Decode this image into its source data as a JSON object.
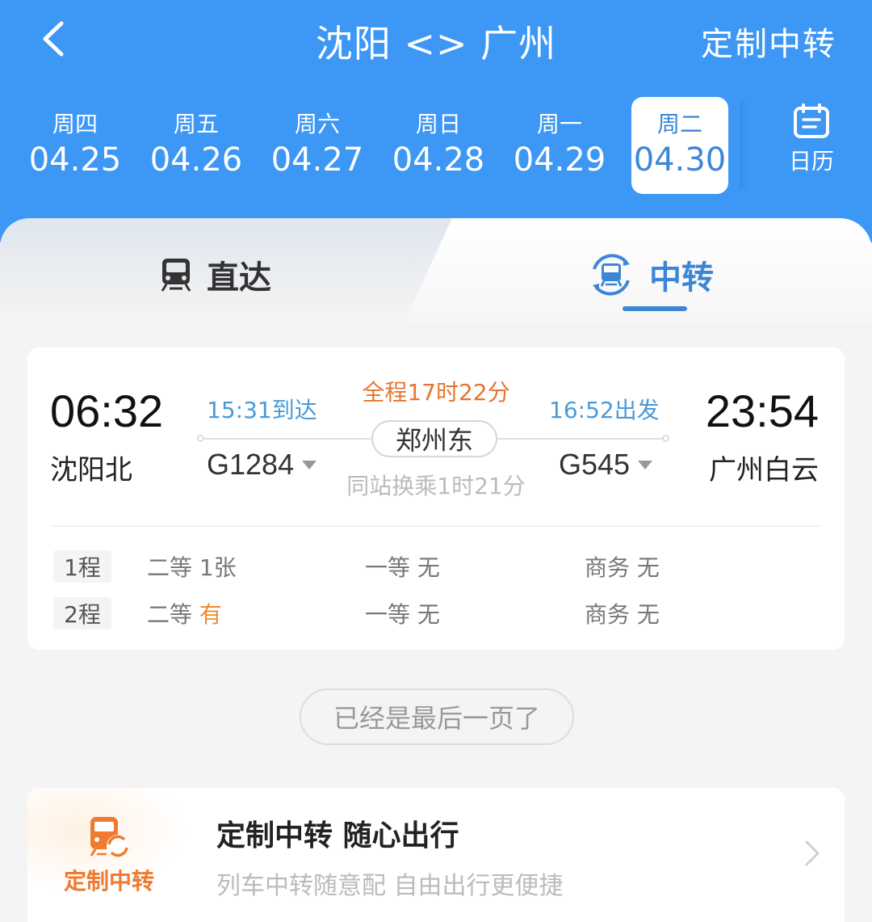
{
  "header": {
    "title": "沈阳 <> 广州",
    "custom_transfer_link": "定制中转",
    "back_icon": "chevron-left-icon",
    "colors": {
      "brand": "#3d97f5",
      "active_date_text": "#3d86d6"
    }
  },
  "dates": [
    {
      "weekday": "周四",
      "date": "04.25",
      "selected": false
    },
    {
      "weekday": "周五",
      "date": "04.26",
      "selected": false
    },
    {
      "weekday": "周六",
      "date": "04.27",
      "selected": false
    },
    {
      "weekday": "周日",
      "date": "04.28",
      "selected": false
    },
    {
      "weekday": "周一",
      "date": "04.29",
      "selected": false
    },
    {
      "weekday": "周二",
      "date": "04.30",
      "selected": true
    }
  ],
  "calendar": {
    "label": "日历",
    "icon": "calendar-icon"
  },
  "tabs": [
    {
      "label": "直达",
      "icon": "train-icon",
      "active": false
    },
    {
      "label": "中转",
      "icon": "train-transfer-icon",
      "active": true
    }
  ],
  "result": {
    "departure_time": "06:32",
    "departure_station": "沈阳北",
    "arrival_time": "23:54",
    "arrival_station": "广州白云",
    "total_duration": "全程17时22分",
    "transfer_station": "郑州东",
    "transfer_info": "同站换乘1时21分",
    "leg1": {
      "train_no": "G1284",
      "arrive_text": "15:31到达"
    },
    "leg2": {
      "train_no": "G545",
      "depart_text": "16:52出发"
    },
    "seats": [
      {
        "leg": "1程",
        "classes": [
          {
            "name": "二等",
            "value": "1张",
            "available": false
          },
          {
            "name": "一等",
            "value": "无",
            "available": false
          },
          {
            "name": "商务",
            "value": "无",
            "available": false
          }
        ]
      },
      {
        "leg": "2程",
        "classes": [
          {
            "name": "二等",
            "value": "有",
            "available": true
          },
          {
            "name": "一等",
            "value": "无",
            "available": false
          },
          {
            "name": "商务",
            "value": "无",
            "available": false
          }
        ]
      }
    ]
  },
  "last_page_text": "已经是最后一页了",
  "promo": {
    "badge": "定制中转",
    "title": "定制中转 随心出行",
    "subtitle": "列车中转随意配 自由出行更便捷",
    "accent": "#ef7a30"
  }
}
